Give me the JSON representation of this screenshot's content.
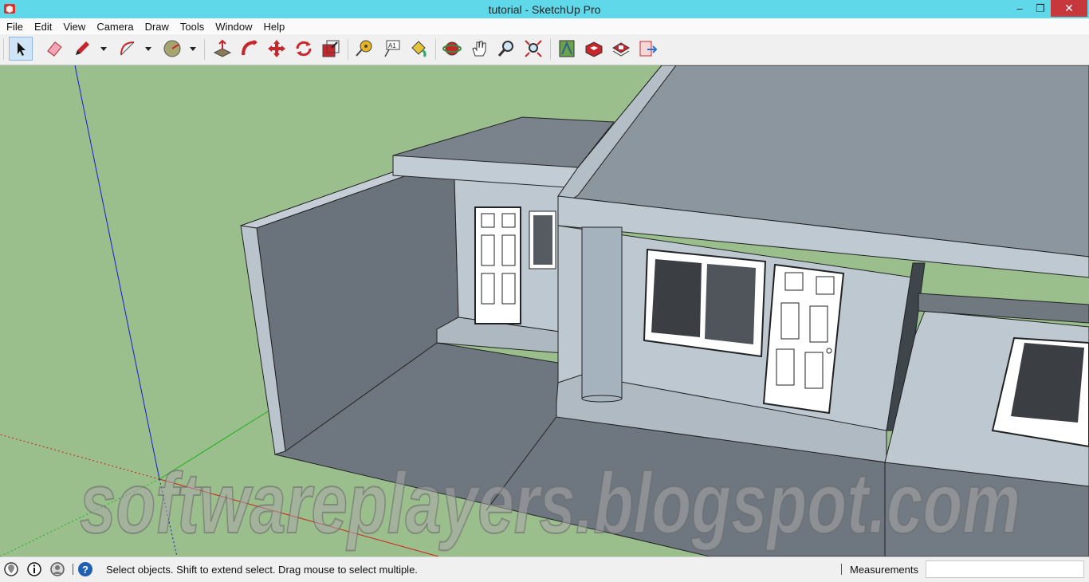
{
  "window": {
    "title": "tutorial - SketchUp Pro",
    "minimize": "–",
    "maximize": "❐",
    "close": "✕"
  },
  "menu": [
    "File",
    "Edit",
    "View",
    "Camera",
    "Draw",
    "Tools",
    "Window",
    "Help"
  ],
  "toolbar": {
    "tools": [
      "select-icon",
      "eraser-icon",
      "pencil-icon",
      "arc-icon",
      "circle-icon",
      "push-pull-icon",
      "follow-me-icon",
      "move-icon",
      "rotate-icon",
      "scale-icon",
      "tape-measure-icon",
      "text-icon",
      "paint-bucket-icon",
      "orbit-icon",
      "pan-icon",
      "zoom-icon",
      "zoom-extents-icon",
      "3d-warehouse-icon",
      "extension-warehouse-icon",
      "layout-icon",
      "send-to-layout-icon"
    ],
    "active": "select-icon"
  },
  "viewport": {
    "watermark": "softwareplayers.blogspot.com",
    "sky_color": "#9bbf8c",
    "ground_color": "#9bbf8c"
  },
  "status": {
    "message": "Select objects. Shift to extend select. Drag mouse to select multiple.",
    "measurements_label": "Measurements",
    "measurements_value": ""
  }
}
